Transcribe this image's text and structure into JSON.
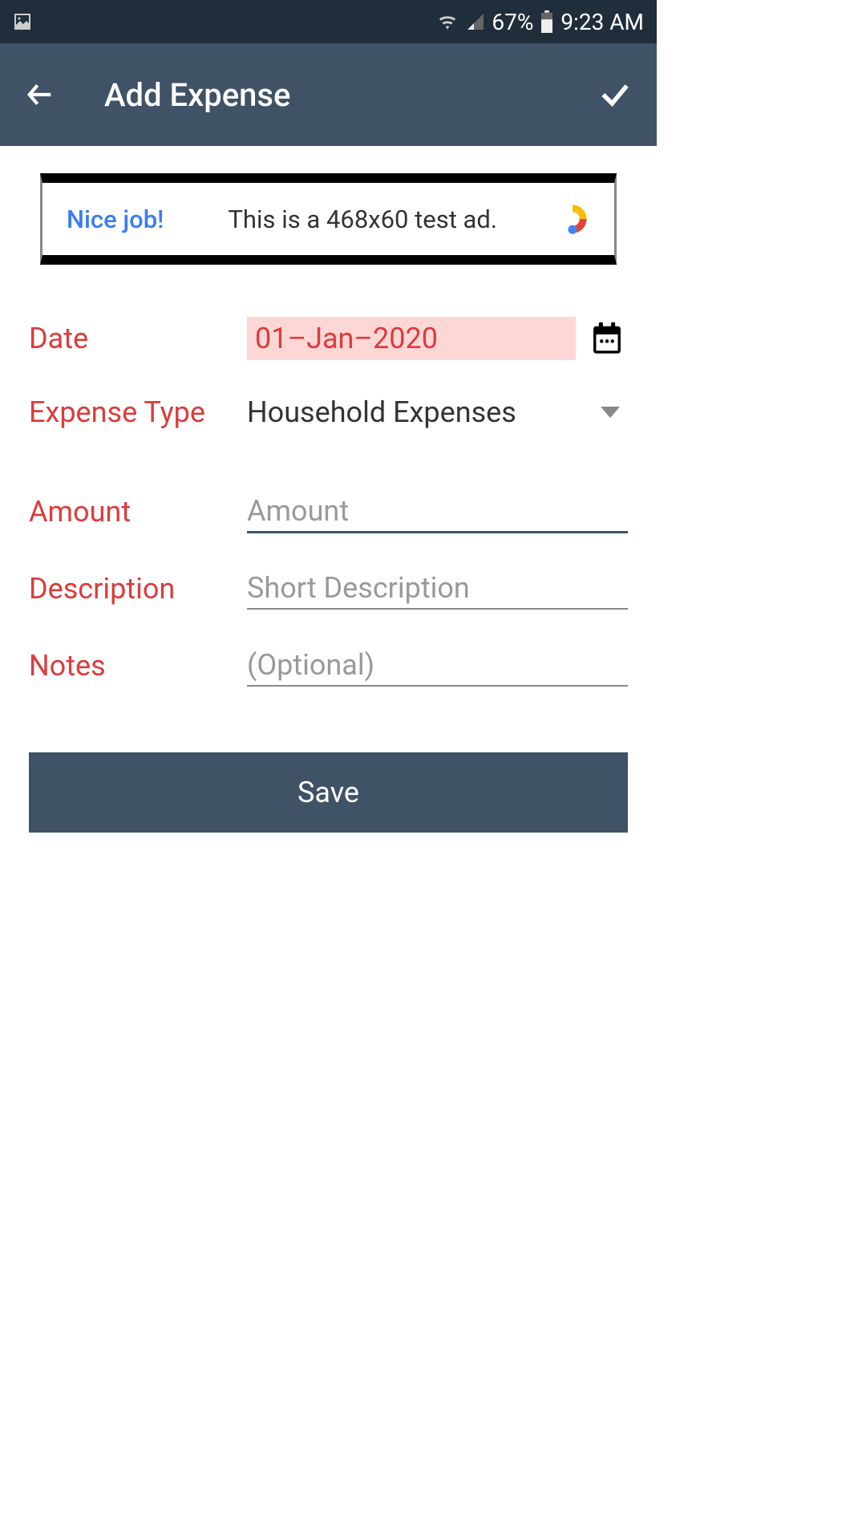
{
  "status_bar": {
    "battery_percent": "67%",
    "time": "9:23 AM"
  },
  "app_bar": {
    "title": "Add Expense"
  },
  "ad": {
    "nice": "Nice job!",
    "text": "This is a 468x60 test ad."
  },
  "form": {
    "date_label": "Date",
    "date_value": "01–Jan–2020",
    "expense_type_label": "Expense Type",
    "expense_type_value": "Household Expenses",
    "amount_label": "Amount",
    "amount_placeholder": "Amount",
    "description_label": "Description",
    "description_placeholder": "Short Description",
    "notes_label": "Notes",
    "notes_placeholder": "(Optional)",
    "save_label": "Save"
  }
}
